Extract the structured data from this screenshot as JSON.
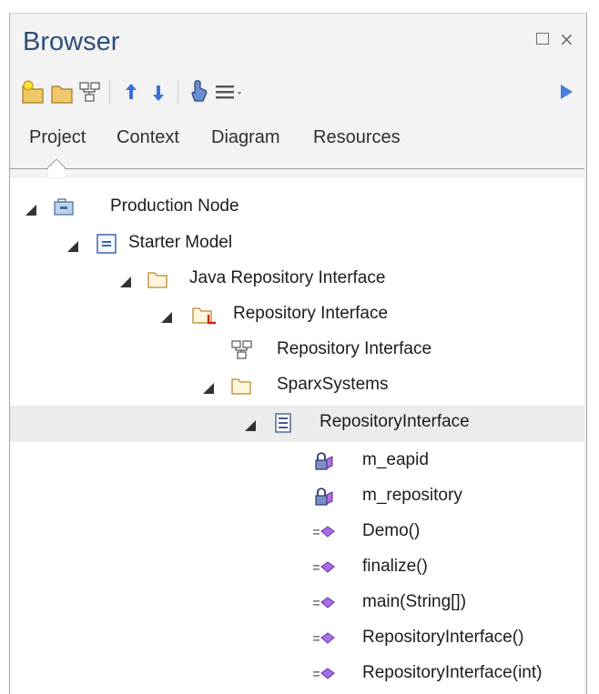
{
  "window": {
    "title": "Browser"
  },
  "tabs": [
    {
      "label": "Project"
    },
    {
      "label": "Context"
    },
    {
      "label": "Diagram"
    },
    {
      "label": "Resources"
    }
  ],
  "toolbar_icons": [
    "new-package-icon",
    "folder-icon",
    "diagram-icon",
    "move-up-icon",
    "move-down-icon",
    "locate-icon",
    "menu-icon",
    "forward-icon"
  ],
  "colors": {
    "title": "#2d4f7a",
    "accent": "#3d6fd9",
    "selected_row": "#ececec"
  },
  "tree": {
    "items": [
      {
        "label": "Production Node",
        "level": 0,
        "icon": "root-node-icon",
        "expanded": true
      },
      {
        "label": "Starter Model",
        "level": 1,
        "icon": "model-icon",
        "expanded": true
      },
      {
        "label": "Java Repository Interface",
        "level": 2,
        "icon": "package-folder-icon",
        "expanded": true
      },
      {
        "label": "Repository Interface",
        "level": 3,
        "icon": "namespace-package-icon",
        "expanded": true
      },
      {
        "label": "Repository Interface",
        "level": 4,
        "icon": "diagram-icon",
        "expanded": false
      },
      {
        "label": "SparxSystems",
        "level": 4,
        "icon": "package-folder-icon",
        "expanded": true
      },
      {
        "label": "RepositoryInterface",
        "level": 5,
        "icon": "class-icon",
        "expanded": true,
        "selected": true
      },
      {
        "label": "m_eapid",
        "level": 6,
        "icon": "private-attribute-icon",
        "expanded": false
      },
      {
        "label": "m_repository",
        "level": 6,
        "icon": "private-attribute-icon",
        "expanded": false
      },
      {
        "label": "Demo()",
        "level": 6,
        "icon": "operation-icon",
        "expanded": false
      },
      {
        "label": "finalize()",
        "level": 6,
        "icon": "operation-icon",
        "expanded": false
      },
      {
        "label": "main(String[])",
        "level": 6,
        "icon": "operation-icon",
        "expanded": false
      },
      {
        "label": "RepositoryInterface()",
        "level": 6,
        "icon": "operation-icon",
        "expanded": false
      },
      {
        "label": "RepositoryInterface(int)",
        "level": 6,
        "icon": "operation-icon",
        "expanded": false
      }
    ]
  }
}
